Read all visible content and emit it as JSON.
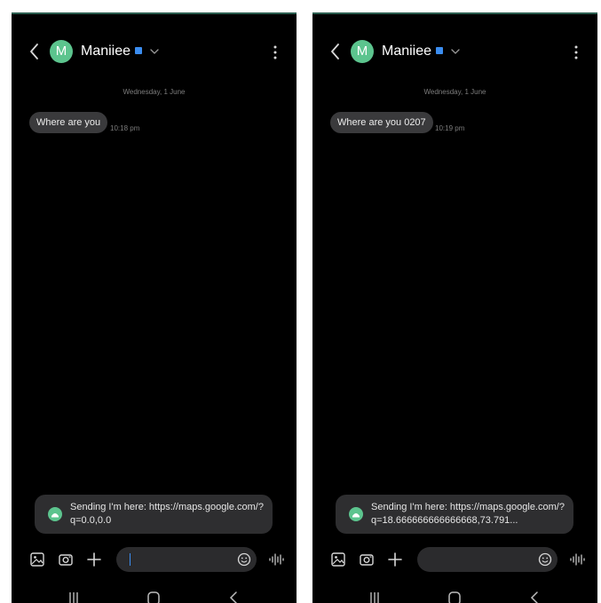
{
  "screens": [
    {
      "contact": {
        "name": "Maniiee",
        "avatar_letter": "M"
      },
      "date_separator": "Wednesday, 1 June",
      "message": {
        "text": "Where are you",
        "time": "10:18 pm"
      },
      "sending": {
        "text": "Sending I'm here: https://maps.google.com/?q=0.0,0.0"
      }
    },
    {
      "contact": {
        "name": "Maniiee",
        "avatar_letter": "M"
      },
      "date_separator": "Wednesday, 1 June",
      "message": {
        "text": "Where are you 0207",
        "time": "10:19 pm"
      },
      "sending": {
        "text": "Sending I'm here: https://maps.google.com/?q=18.666666666666668,73.791..."
      }
    }
  ],
  "colors": {
    "background": "#000000",
    "avatar": "#5cc48e",
    "bubble": "#3a3a3c",
    "badge": "#3b8df0",
    "icon": "#d8d8d8"
  },
  "icons": [
    "back-icon",
    "chevron-down-icon",
    "more-vert-icon",
    "gallery-icon",
    "camera-icon",
    "plus-icon",
    "emoji-icon",
    "voice-icon",
    "maps-icon",
    "recents-icon",
    "home-icon",
    "nav-back-icon"
  ]
}
